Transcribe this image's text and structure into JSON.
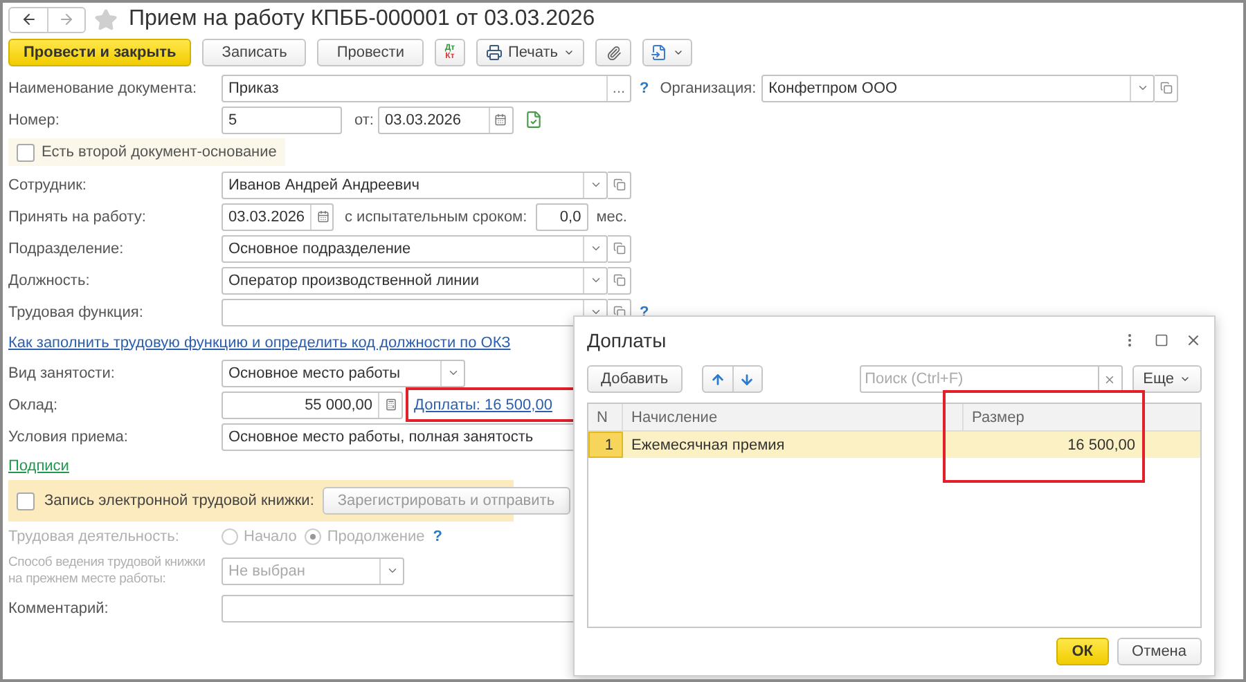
{
  "window": {
    "title": "Прием на работу КПББ-000001 от 03.03.2026",
    "favorite": false
  },
  "toolbar": [
    {
      "kind": "primary",
      "label": "Провести и закрыть"
    },
    {
      "kind": "button",
      "label": "Записать"
    },
    {
      "kind": "button",
      "label": "Провести"
    },
    {
      "kind": "dtkt",
      "top": "Дт",
      "bottom": "Кт"
    },
    {
      "kind": "menu",
      "label": "Печать"
    },
    {
      "kind": "attach"
    },
    {
      "kind": "export"
    }
  ],
  "header": {
    "doc_name": {
      "label": "Наименование документа:",
      "value": "Приказ",
      "button": "...",
      "help": "?"
    },
    "organization": {
      "label": "Организация:",
      "value": "Конфетпром ООО"
    },
    "number": {
      "label": "Номер:",
      "value": "5"
    },
    "date": {
      "label": "от:",
      "value": "03.03.2026"
    },
    "second_basis": {
      "label": "Есть второй документ-основание",
      "checked": false
    }
  },
  "rows": [
    {
      "kind": "choice",
      "label": "Сотрудник:",
      "value": "Иванов Андрей Андреевич"
    },
    {
      "kind": "hire-date",
      "label": "Принять на работу:",
      "value": "03.03.2026",
      "probation_label": "с испытательным сроком:",
      "probation": "0,0",
      "unit": "мес."
    },
    {
      "kind": "choice",
      "label": "Подразделение:",
      "value": "Основное подразделение"
    },
    {
      "kind": "choice",
      "label": "Должность:",
      "value": "Оператор производственной линии"
    },
    {
      "kind": "choice",
      "label": "Трудовая функция:",
      "help": "?"
    },
    {
      "kind": "link",
      "text": "Как заполнить трудовую функцию и определить код должности по ОКЗ",
      "color": "#2a5fb0"
    },
    {
      "kind": "dropdown",
      "label": "Вид занятости:",
      "value": "Основное место работы",
      "disabled": false
    },
    {
      "kind": "salary",
      "label": "Оклад:",
      "value": "55 000,00",
      "link": "Доплаты: 16 500,00",
      "highlighted": true
    },
    {
      "kind": "text",
      "label": "Условия приема:",
      "value": "Основное место работы, полная занятость"
    },
    {
      "kind": "link",
      "text": "Подписи",
      "color": "#1f9a4c"
    },
    {
      "kind": "etk",
      "label": "Запись электронной трудовой книжки:",
      "checked": false,
      "button": "Зарегистрировать и отправить",
      "button_disabled": true
    },
    {
      "kind": "radio",
      "label": "Трудовая деятельность:",
      "disabled": true,
      "help": "?",
      "options": [
        {
          "label": "Начало",
          "selected": false
        },
        {
          "label": "Продолжение",
          "selected": true
        }
      ]
    },
    {
      "kind": "dropdown",
      "label": "Способ ведения трудовой книжки на прежнем месте работы:",
      "value": "Не выбран",
      "disabled": true
    },
    {
      "kind": "text",
      "label": "Комментарий:"
    }
  ],
  "dialog": {
    "title": "Доплаты",
    "add_button": "Добавить",
    "search": {
      "placeholder": "Поиск (Ctrl+F)"
    },
    "more_button": "Еще",
    "columns": [
      {
        "label": "N",
        "highlighted": false
      },
      {
        "label": "Начисление",
        "highlighted": false
      },
      {
        "label": "Размер",
        "highlighted": true
      }
    ],
    "rows": [
      {
        "selected": true,
        "cells": [
          "1",
          "Ежемесячная премия",
          "16 500,00"
        ]
      }
    ],
    "ok": "ОК",
    "cancel": "Отмена"
  }
}
